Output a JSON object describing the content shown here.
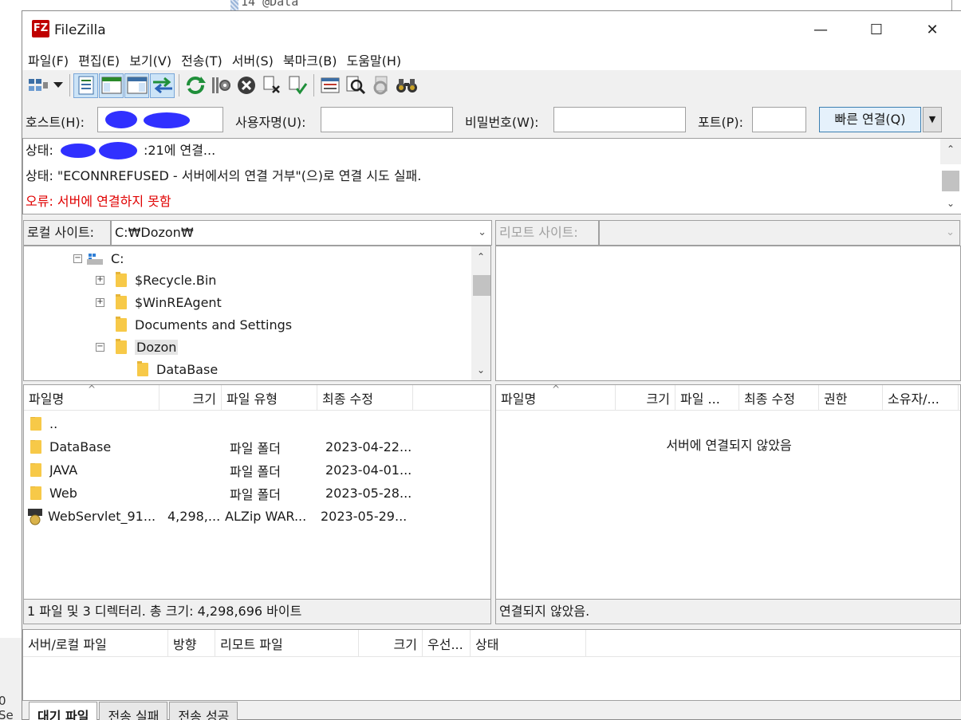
{
  "background": {
    "editor_line": "14  @Data",
    "side_fragment": "0 Se"
  },
  "window": {
    "title": "FileZilla",
    "icon_text": "FZ",
    "minimize_glyph": "—",
    "maximize_glyph": "☐",
    "close_glyph": "✕"
  },
  "menu": [
    "파일(F)",
    "편집(E)",
    "보기(V)",
    "전송(T)",
    "서버(S)",
    "북마크(B)",
    "도움말(H)"
  ],
  "quickconnect": {
    "host_label": "호스트(H):",
    "host_value": "",
    "user_label": "사용자명(U):",
    "user_value": "",
    "pass_label": "비밀번호(W):",
    "pass_value": "",
    "port_label": "포트(P):",
    "port_value": "",
    "connect_label": "빠른 연결(Q)",
    "dropdown_glyph": "▼"
  },
  "log": {
    "line1_prefix": "상태:",
    "line1_suffix": ":21에 연결...",
    "line2": "상태: \"ECONNREFUSED - 서버에서의 연결 거부\"(으)로 연결 시도 실패.",
    "line3": "오류: 서버에 연결하지 못함"
  },
  "local": {
    "site_label": "로컬 사이트:",
    "path": "C:₩Dozon₩",
    "tree": [
      {
        "label": "C:"
      },
      {
        "label": "$Recycle.Bin"
      },
      {
        "label": "$WinREAgent"
      },
      {
        "label": "Documents and Settings"
      },
      {
        "label": "Dozon"
      },
      {
        "label": "DataBase"
      }
    ],
    "columns": [
      "파일명",
      "크기",
      "파일 유형",
      "최종 수정"
    ],
    "files": [
      {
        "name": "..",
        "size": "",
        "type": "",
        "modified": ""
      },
      {
        "name": "DataBase",
        "size": "",
        "type": "파일 폴더",
        "modified": "2023-04-22..."
      },
      {
        "name": "JAVA",
        "size": "",
        "type": "파일 폴더",
        "modified": "2023-04-01..."
      },
      {
        "name": "Web",
        "size": "",
        "type": "파일 폴더",
        "modified": "2023-05-28..."
      },
      {
        "name": "WebServlet_91...",
        "size": "4,298,...",
        "type": "ALZip WAR...",
        "modified": "2023-05-29..."
      }
    ],
    "status": "1 파일 및 3 디렉터리. 총 크기: 4,298,696 바이트"
  },
  "remote": {
    "site_label": "리모트 사이트:",
    "path": "",
    "columns": [
      "파일명",
      "크기",
      "파일 ...",
      "최종 수정",
      "권한",
      "소유자/..."
    ],
    "empty_message": "서버에 연결되지 않았음",
    "status": "연결되지 않았음."
  },
  "queue": {
    "columns": [
      "서버/로컬 파일",
      "방향",
      "리모트 파일",
      "크기",
      "우선...",
      "상태"
    ]
  },
  "tabs": [
    "대기 파일",
    "전송 실패",
    "전송 성공"
  ]
}
